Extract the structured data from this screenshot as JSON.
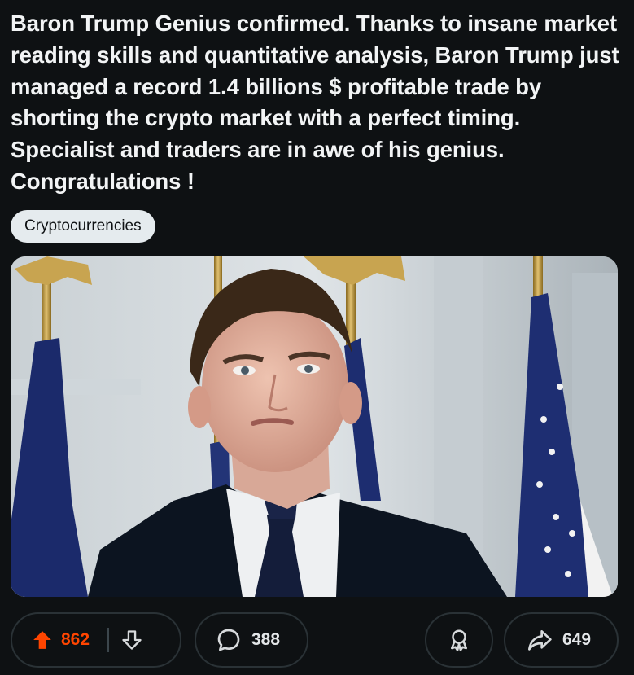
{
  "post": {
    "title": "Baron Trump Genius confirmed. Thanks to insane market reading skills and quantitative analysis, Baron Trump just managed a record 1.4 billions $ profitable trade by shorting the crypto market with a perfect timing. Specialist and traders are in awe of his genius. Congratulations !",
    "flair": "Cryptocurrencies"
  },
  "actions": {
    "score": "862",
    "comments": "388",
    "shares": "649"
  },
  "colors": {
    "background": "#0e1113",
    "upvote_active": "#ff4500",
    "flair_bg": "#e5ebee",
    "pill_border": "#2a3236"
  },
  "icons": [
    "upvote-icon",
    "downvote-icon",
    "comment-icon",
    "award-icon",
    "share-icon"
  ]
}
